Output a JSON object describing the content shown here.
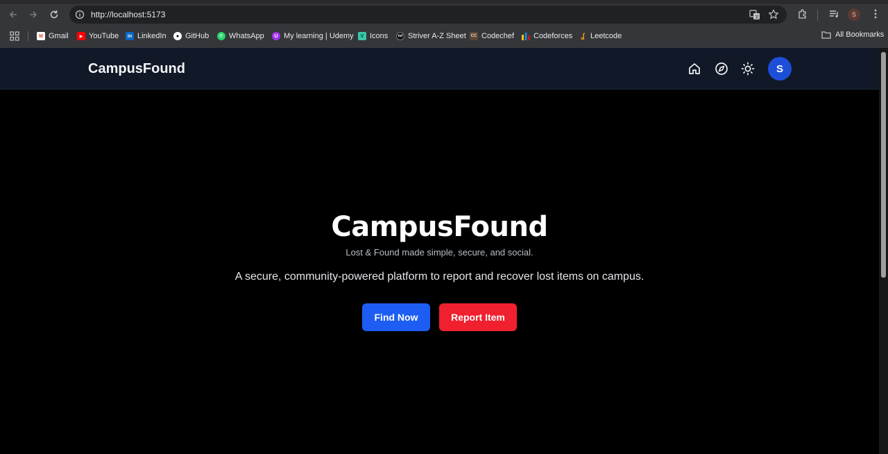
{
  "browser": {
    "url": "http://localhost:5173",
    "profile_initial": "S",
    "bookmarks": [
      {
        "label": "Gmail",
        "icon": "gmail-icon",
        "color": "#ea4335"
      },
      {
        "label": "YouTube",
        "icon": "youtube-icon",
        "color": "#ff0000"
      },
      {
        "label": "LinkedIn",
        "icon": "linkedin-icon",
        "color": "#0a66c2"
      },
      {
        "label": "GitHub",
        "icon": "github-icon",
        "color": "#ffffff"
      },
      {
        "label": "WhatsApp",
        "icon": "whatsapp-icon",
        "color": "#25d366"
      },
      {
        "label": "My learning | Udemy",
        "icon": "udemy-icon",
        "color": "#a435f0"
      },
      {
        "label": "Icons",
        "icon": "icons-icon",
        "color": "#3ac6a8"
      },
      {
        "label": "Striver A-Z Sheet",
        "icon": "striver-icon",
        "color": "#111111"
      },
      {
        "label": "Codechef",
        "icon": "codechef-icon",
        "color": "#5b4638"
      },
      {
        "label": "Codeforces",
        "icon": "codeforces-icon",
        "color": "#1f8acb"
      },
      {
        "label": "Leetcode",
        "icon": "leetcode-icon",
        "color": "#ffa116"
      }
    ],
    "all_bookmarks": "All Bookmarks"
  },
  "header": {
    "brand": "CampusFound",
    "avatar_initial": "S"
  },
  "hero": {
    "title": "CampusFound",
    "subtitle": "Lost & Found made simple, secure, and social.",
    "description": "A secure, community-powered platform to report and recover lost items on campus.",
    "find_label": "Find Now",
    "report_label": "Report Item"
  },
  "colors": {
    "header_bg": "#111827",
    "primary": "#1d5df3",
    "danger": "#f0202f",
    "avatar": "#1d4ed8"
  }
}
